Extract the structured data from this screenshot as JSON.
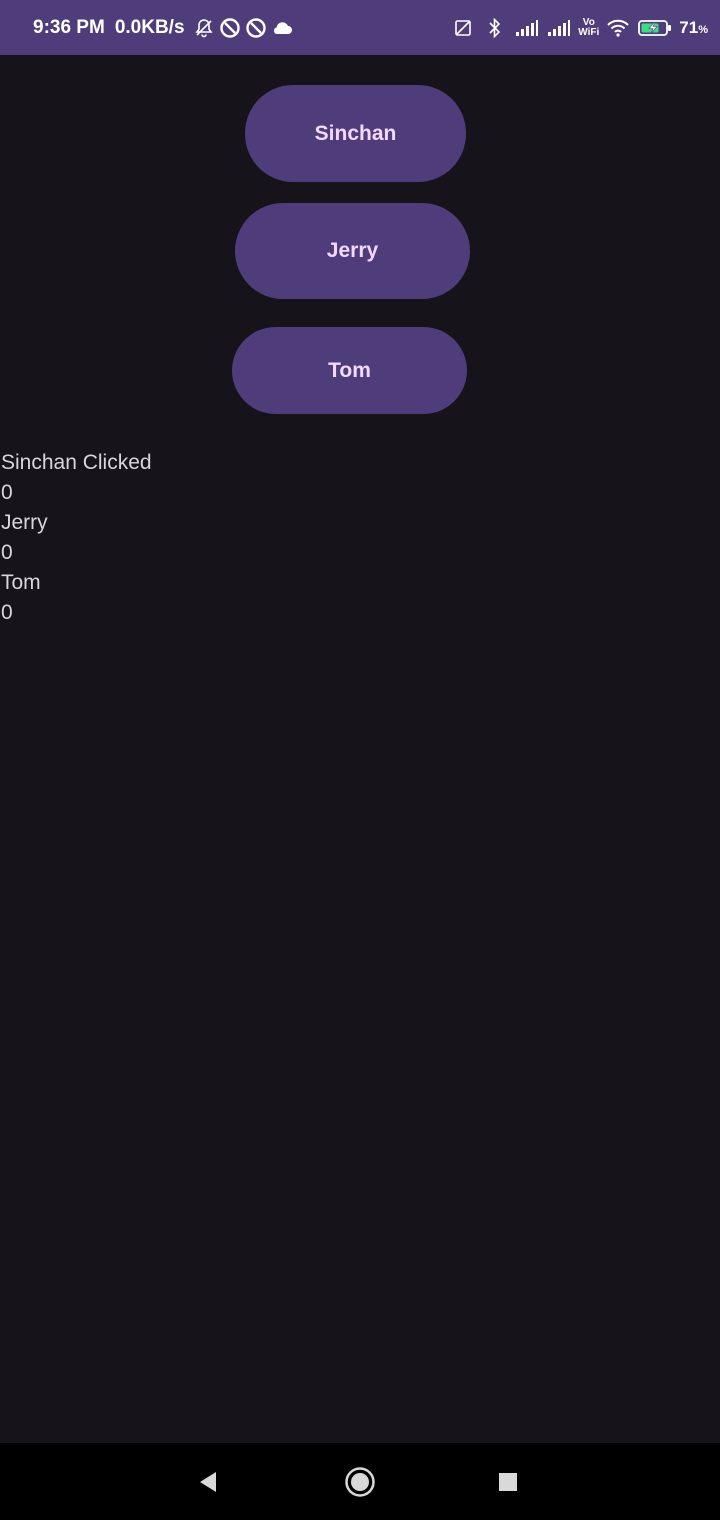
{
  "status_bar": {
    "time": "9:36 PM",
    "network_speed": "0.0KB/s",
    "battery_percent": "71",
    "battery_unit": "%",
    "volte_top": "Vo",
    "volte_bottom": "WiFi",
    "icons": [
      "mute-icon",
      "data-saver-icon",
      "data-saver-icon",
      "cloud-icon",
      "no-sim-icon",
      "bluetooth-icon",
      "signal-icon",
      "signal-icon",
      "volte-wifi-icon",
      "wifi-icon",
      "battery-charging-icon"
    ],
    "background_color": "#4f3d7b"
  },
  "buttons": {
    "sinchan": "Sinchan",
    "jerry": "Jerry",
    "tom": "Tom",
    "color": "#4f3d7b",
    "text_color": "#f3d9ff"
  },
  "counters": {
    "sinchan_label": "Sinchan Clicked",
    "sinchan_count": "0",
    "jerry_label": "Jerry",
    "jerry_count": "0",
    "tom_label": "Tom",
    "tom_count": "0"
  },
  "nav_bar": {
    "icons": [
      "back-icon",
      "home-icon",
      "recents-icon"
    ]
  },
  "background_color": "#16131b"
}
